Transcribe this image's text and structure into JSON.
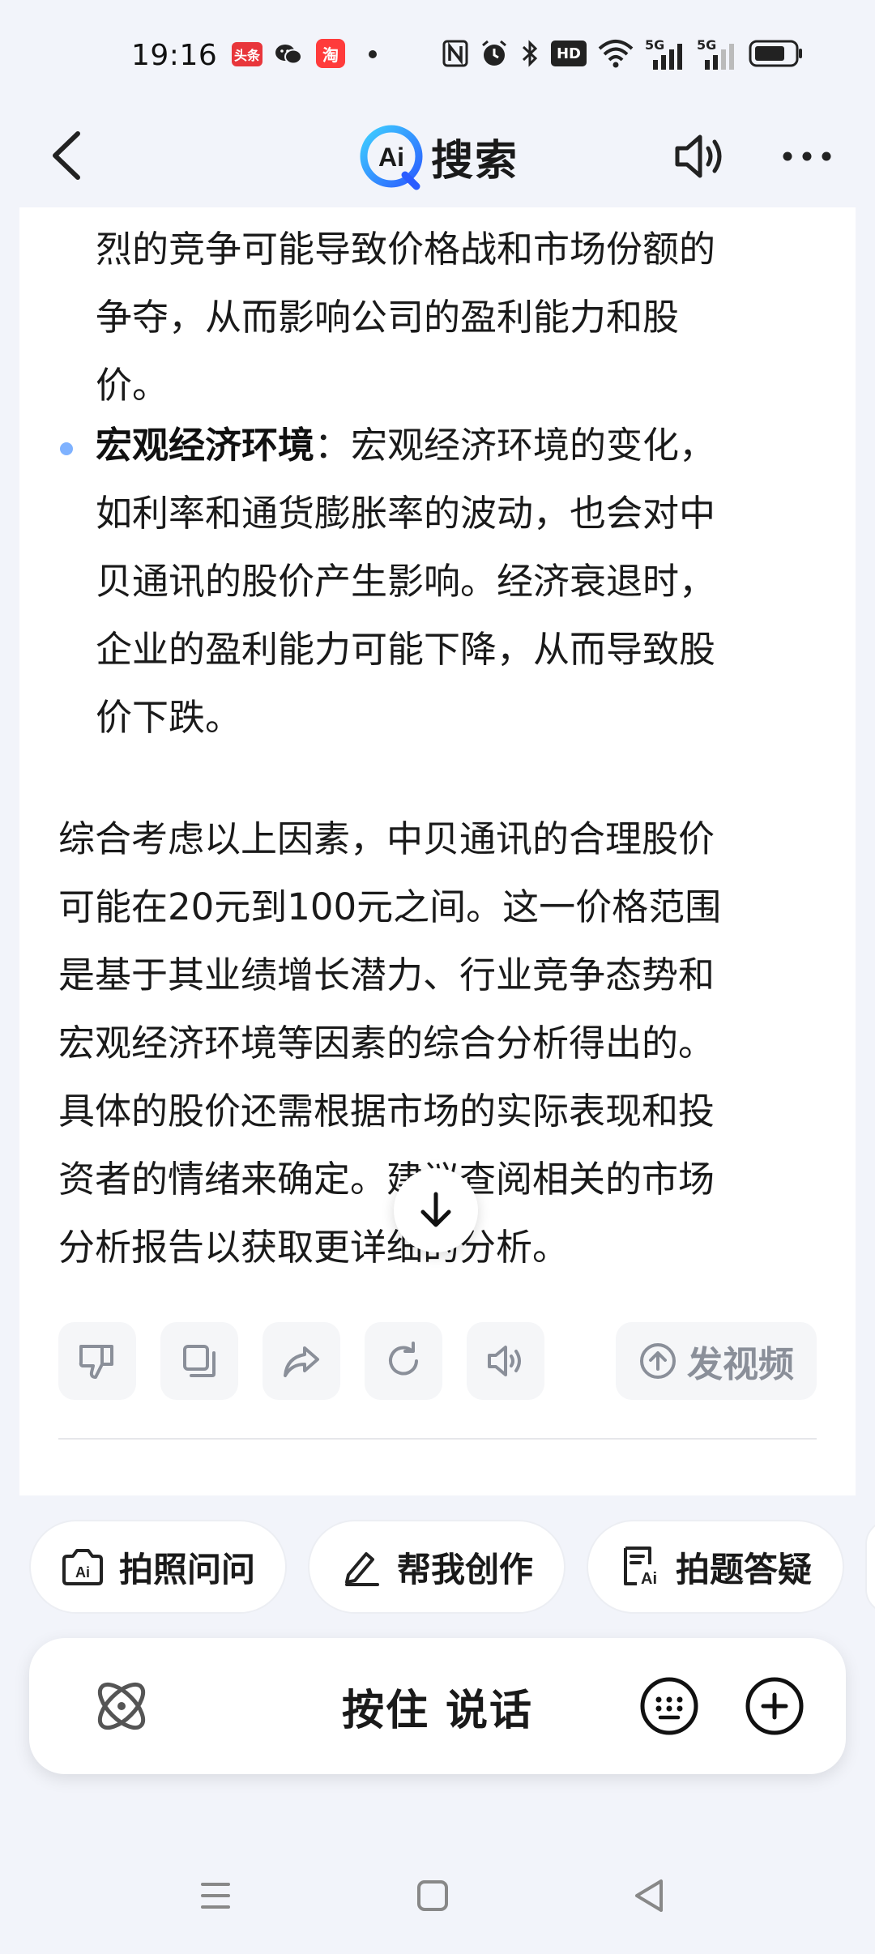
{
  "status_bar": {
    "time": "19:16",
    "app_toutiao": "头条",
    "app_taobao": "淘",
    "icons": [
      "nfc-icon",
      "alarm-icon",
      "bluetooth-icon",
      "hd-icon",
      "wifi-icon",
      "signal-5g-icon",
      "signal-5g-icon",
      "battery-icon"
    ],
    "hd_label": "HD",
    "net1": "5G",
    "net2": "5G"
  },
  "header": {
    "logo_mark": "Ai",
    "title": "搜索"
  },
  "content": {
    "line_top_1": "烈的竞争可能导致价格战和市场份额的",
    "line_top_2": "争夺，从而影响公司的盈利能力和股",
    "line_top_3": "价。",
    "bullet_title": "宏观经济环境",
    "bullet_line_1": "：宏观经济环境的变化，",
    "bullet_line_2": "如利率和通货膨胀率的波动，也会对中",
    "bullet_line_3": "贝通讯的股价产生影响。经济衰退时，",
    "bullet_line_4": "企业的盈利能力可能下降，从而导致股",
    "bullet_line_5": "价下跌。",
    "summary_1": "综合考虑以上因素，中贝通讯的合理股价",
    "summary_2": "可能在20元到100元之间。这一价格范围",
    "summary_3": "是基于其业绩增长潜力、行业竞争态势和",
    "summary_4": "宏观经济环境等因素的综合分析得出的。",
    "summary_5": "具体的股价还需根据市场的实际表现和投",
    "summary_6": "资者的情绪来确定。建议查阅相关的市场",
    "summary_7": "分析报告以获取更详细的分析。"
  },
  "actions": {
    "video_label": "发视频"
  },
  "chips": [
    {
      "label": "拍照问问"
    },
    {
      "label": "帮我创作"
    },
    {
      "label": "拍题答疑"
    }
  ],
  "input": {
    "talk_label": "按住 说话"
  },
  "colors": {
    "background": "#f2f4fa",
    "card": "#ffffff",
    "accent_blue": "#2b7cff",
    "bullet": "#7fb2ff"
  }
}
